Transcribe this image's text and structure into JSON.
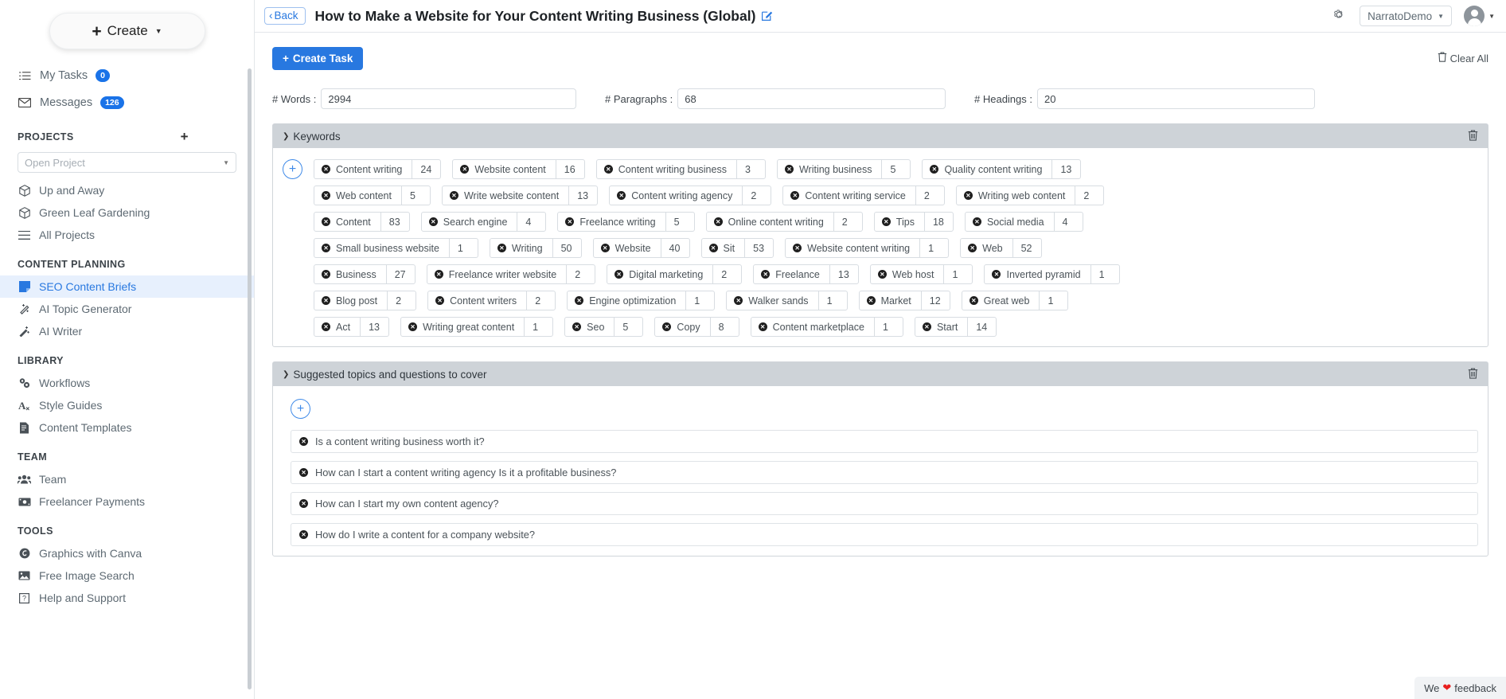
{
  "sidebar": {
    "create_label": "Create",
    "nav": [
      {
        "label": "My Tasks",
        "icon": "tasks-icon",
        "badge": "0"
      },
      {
        "label": "Messages",
        "icon": "envelope-icon",
        "badge": "126"
      }
    ],
    "projects_title": "PROJECTS",
    "project_select_placeholder": "Open Project",
    "projects": [
      {
        "label": "Up and Away",
        "icon": "cube-icon"
      },
      {
        "label": "Green Leaf Gardening",
        "icon": "cube-icon"
      },
      {
        "label": "All Projects",
        "icon": "list-icon"
      }
    ],
    "content_planning_title": "CONTENT PLANNING",
    "content_planning": [
      {
        "label": "SEO Content Briefs",
        "icon": "note-icon",
        "active": true
      },
      {
        "label": "AI Topic Generator",
        "icon": "sparkle-icon",
        "active": false
      },
      {
        "label": "AI Writer",
        "icon": "magic-wand-icon",
        "active": false
      }
    ],
    "library_title": "LIBRARY",
    "library": [
      {
        "label": "Workflows",
        "icon": "gears-icon"
      },
      {
        "label": "Style Guides",
        "icon": "typography-icon"
      },
      {
        "label": "Content Templates",
        "icon": "document-icon"
      }
    ],
    "team_title": "TEAM",
    "team": [
      {
        "label": "Team",
        "icon": "people-icon"
      },
      {
        "label": "Freelancer Payments",
        "icon": "money-icon"
      }
    ],
    "tools_title": "TOOLS",
    "tools": [
      {
        "label": "Graphics with Canva",
        "icon": "canva-icon"
      },
      {
        "label": "Free Image Search",
        "icon": "image-icon"
      },
      {
        "label": "Help and Support",
        "icon": "help-icon"
      }
    ]
  },
  "topbar": {
    "back_label": "Back",
    "title": "How to Make a Website for Your Content Writing Business (Global)",
    "org_name": "NarratoDemo"
  },
  "toolbar": {
    "create_task_label": "Create Task",
    "clear_all_label": "Clear All"
  },
  "stats": [
    {
      "label": "# Words :",
      "value": "2994"
    },
    {
      "label": "# Paragraphs :",
      "value": "68"
    },
    {
      "label": "# Headings :",
      "value": "20"
    }
  ],
  "keywords_panel": {
    "title": "Keywords",
    "rows": [
      [
        {
          "label": "Content writing",
          "count": "24"
        },
        {
          "label": "Website content",
          "count": "16"
        },
        {
          "label": "Content writing business",
          "count": "3"
        },
        {
          "label": "Writing business",
          "count": "5"
        },
        {
          "label": "Quality content writing",
          "count": "13"
        }
      ],
      [
        {
          "label": "Web content",
          "count": "5"
        },
        {
          "label": "Write website content",
          "count": "13"
        },
        {
          "label": "Content writing agency",
          "count": "2"
        },
        {
          "label": "Content writing service",
          "count": "2"
        },
        {
          "label": "Writing web content",
          "count": "2"
        }
      ],
      [
        {
          "label": "Content",
          "count": "83"
        },
        {
          "label": "Search engine",
          "count": "4"
        },
        {
          "label": "Freelance writing",
          "count": "5"
        },
        {
          "label": "Online content writing",
          "count": "2"
        },
        {
          "label": "Tips",
          "count": "18"
        },
        {
          "label": "Social media",
          "count": "4"
        }
      ],
      [
        {
          "label": "Small business website",
          "count": "1"
        },
        {
          "label": "Writing",
          "count": "50"
        },
        {
          "label": "Website",
          "count": "40"
        },
        {
          "label": "Sit",
          "count": "53"
        },
        {
          "label": "Website content writing",
          "count": "1"
        },
        {
          "label": "Web",
          "count": "52"
        }
      ],
      [
        {
          "label": "Business",
          "count": "27"
        },
        {
          "label": "Freelance writer website",
          "count": "2"
        },
        {
          "label": "Digital marketing",
          "count": "2"
        },
        {
          "label": "Freelance",
          "count": "13"
        },
        {
          "label": "Web host",
          "count": "1"
        },
        {
          "label": "Inverted pyramid",
          "count": "1"
        }
      ],
      [
        {
          "label": "Blog post",
          "count": "2"
        },
        {
          "label": "Content writers",
          "count": "2"
        },
        {
          "label": "Engine optimization",
          "count": "1"
        },
        {
          "label": "Walker sands",
          "count": "1"
        },
        {
          "label": "Market",
          "count": "12"
        },
        {
          "label": "Great web",
          "count": "1"
        }
      ],
      [
        {
          "label": "Act",
          "count": "13"
        },
        {
          "label": "Writing great content",
          "count": "1"
        },
        {
          "label": "Seo",
          "count": "5"
        },
        {
          "label": "Copy",
          "count": "8"
        },
        {
          "label": "Content marketplace",
          "count": "1"
        },
        {
          "label": "Start",
          "count": "14"
        }
      ]
    ]
  },
  "topics_panel": {
    "title": "Suggested topics and questions to cover",
    "items": [
      "Is a content writing business worth it?",
      "How can I start a content writing agency Is it a profitable business?",
      "How can I start my own content agency?",
      "How do I write a content for a company website?"
    ]
  },
  "feedback": {
    "prefix": "We",
    "suffix": "feedback"
  }
}
